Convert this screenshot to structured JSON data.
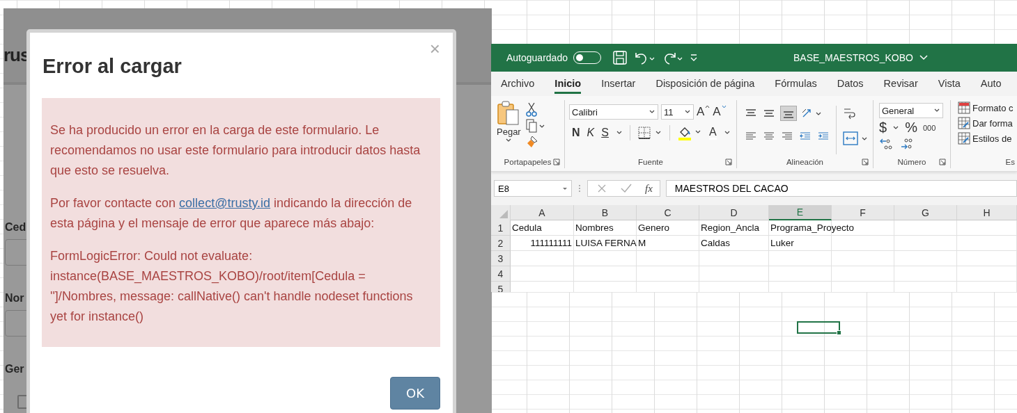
{
  "back_page": {
    "logo": "rus",
    "labels": [
      "Ced",
      "Nor",
      "Ger"
    ],
    "checkbox": {
      "checked": false
    }
  },
  "dialog": {
    "title": "Error al cargar",
    "close": "×",
    "intro": "Se ha producido un error en la carga de este formulario. Le recomendamos no usar este formulario para introducir datos hasta que esto se resuelva.",
    "contact_before": "Por favor contacte con",
    "contact_link": "collect@trusty.id",
    "contact_after": "indicando la dirección de esta página y el mensaje de error que aparece más abajo:",
    "error": "FormLogicError: Could not evaluate: instance(BASE_MAESTROS_KOBO)/root/item[Cedula = '']/Nombres, message: callNative() can't handle nodeset functions yet for instance()",
    "button": "OK"
  },
  "excel": {
    "autosave": {
      "label": "Autoguardado",
      "on": false
    },
    "file_name": "BASE_MAESTROS_KOBO",
    "tabs": [
      {
        "label": "Archivo",
        "selected": false
      },
      {
        "label": "Inicio",
        "selected": true
      },
      {
        "label": "Insertar",
        "selected": false
      },
      {
        "label": "Disposición de página",
        "selected": false
      },
      {
        "label": "Fórmulas",
        "selected": false
      },
      {
        "label": "Datos",
        "selected": false
      },
      {
        "label": "Revisar",
        "selected": false
      },
      {
        "label": "Vista",
        "selected": false
      },
      {
        "label": "Auto",
        "selected": false
      }
    ],
    "ribbon": {
      "clipboard": {
        "paste": "Pegar",
        "label": "Portapapeles"
      },
      "font": {
        "name": "Calibri",
        "size": "11",
        "grow": "A",
        "shrink": "A",
        "styles": [
          {
            "text": "N",
            "kind": "bold"
          },
          {
            "text": "K",
            "kind": "italic"
          },
          {
            "text": "S",
            "kind": "underline"
          }
        ],
        "color_letter": "A",
        "label": "Fuente"
      },
      "alignment": {
        "label": "Alineación"
      },
      "number": {
        "format": "General",
        "currency": "$",
        "percent": "%",
        "thousands": "000",
        "label": "Número"
      },
      "styles": {
        "items": [
          "Formato c",
          "Dar forma",
          "Estilos de"
        ],
        "label": "Es"
      }
    },
    "name_box": "E8",
    "function_label": "fx",
    "formula": "MAESTROS DEL CACAO",
    "columns": [
      {
        "label": "A",
        "selected": false
      },
      {
        "label": "B",
        "selected": false
      },
      {
        "label": "C",
        "selected": false
      },
      {
        "label": "D",
        "selected": false
      },
      {
        "label": "E",
        "selected": true
      },
      {
        "label": "F",
        "selected": false
      },
      {
        "label": "G",
        "selected": false
      },
      {
        "label": "H",
        "selected": false
      }
    ],
    "rows": [
      {
        "label": "1",
        "cells": [
          {
            "text": "Cedula",
            "kind": "text"
          },
          {
            "text": "Nombres",
            "kind": "text"
          },
          {
            "text": "Genero",
            "kind": "text"
          },
          {
            "text": "Region_Ancla",
            "kind": "text"
          },
          {
            "text": "Programa_Proyecto",
            "kind": "text"
          }
        ]
      },
      {
        "label": "2",
        "cells": [
          {
            "text": "111111111",
            "kind": "number"
          },
          {
            "text": "LUISA FERNA",
            "kind": "text"
          },
          {
            "text": "M",
            "kind": "text"
          },
          {
            "text": "Caldas",
            "kind": "text"
          },
          {
            "text": "Luker",
            "kind": "text"
          }
        ]
      },
      {
        "label": "3"
      },
      {
        "label": "4"
      },
      {
        "label": "5"
      }
    ]
  }
}
